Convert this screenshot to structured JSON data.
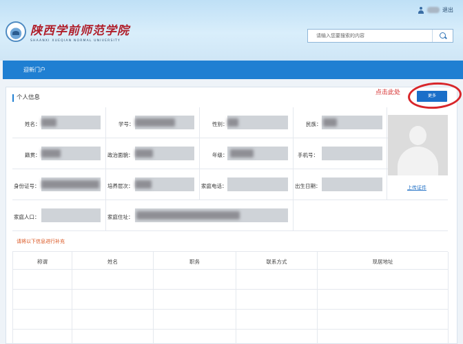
{
  "topbar": {
    "logout_label": "退出"
  },
  "logo": {
    "name_cn": "陕西学前师范学院",
    "name_en": "SHAANXI XUEQIAN NORMAL UNIVERSITY"
  },
  "search": {
    "placeholder": "请输入您要搜索的内容"
  },
  "nav": {
    "items": [
      {
        "label": "迎新门户"
      }
    ]
  },
  "section": {
    "title": "个人信息",
    "more_label": "更多",
    "annotation": "点击此处"
  },
  "fields": {
    "name": "姓名：",
    "student_id": "学号：",
    "gender": "性别：",
    "ethnicity": "民族：",
    "native_place": "籍贯：",
    "political_status": "政治面貌：",
    "grade": "年级：",
    "phone": "手机号：",
    "id_number": "身份证号：",
    "training_level": "培养层次：",
    "home_phone": "家庭电话：",
    "birth_date": "出生日期：",
    "family_size": "家庭人口：",
    "home_address": "家庭住址："
  },
  "upload_label": "上传证件",
  "notice": "请将以下信息进行补充",
  "family_table": {
    "columns": [
      "称谓",
      "姓名",
      "职务",
      "联系方式",
      "现居地址"
    ]
  }
}
